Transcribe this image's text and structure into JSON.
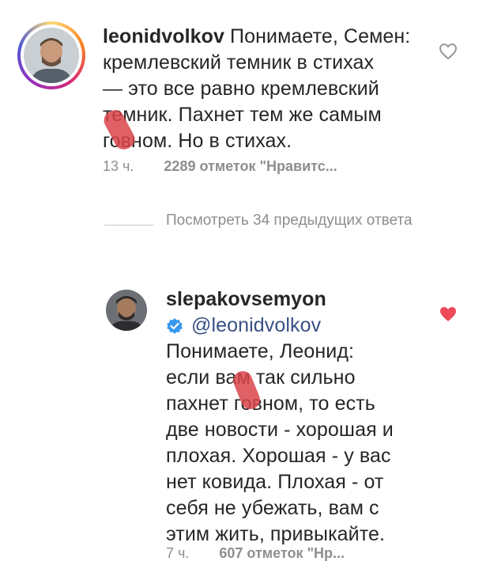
{
  "comment1": {
    "username": "leonidvolkov",
    "lines": [
      " Понимаете, Семен:",
      "кремлевский темник в стихах",
      "— это все равно кремлевский",
      "темник. Пахнет тем же самым",
      "говном. Но в стихах."
    ],
    "time": "13 ч.",
    "likes": "2289 отметок \"Нравитс...",
    "liked": false
  },
  "view_replies": {
    "label": "Посмотреть 34 предыдущих ответа"
  },
  "reply": {
    "username": "slepakovsemyon",
    "mention": "@leonidvolkov",
    "lines": [
      "Понимаете, Леонид:",
      "если вам так сильно",
      "пахнет говном, то есть",
      "две новости - хорошая и",
      "плохая. Хорошая - у вас",
      "нет ковида. Плохая - от",
      "себя не убежать, вам с",
      "этим жить, привыкайте."
    ],
    "time": "7 ч.",
    "likes": "607 отметок \"Нр...",
    "liked": true
  },
  "colors": {
    "text": "#262626",
    "meta": "#8e8e8e",
    "mention": "#385185",
    "verified": "#3897f0",
    "like_red": "#ed4956",
    "redaction": "#d9444a"
  },
  "icons": [
    "heart-outline-icon",
    "heart-filled-icon",
    "verified-badge-icon"
  ]
}
